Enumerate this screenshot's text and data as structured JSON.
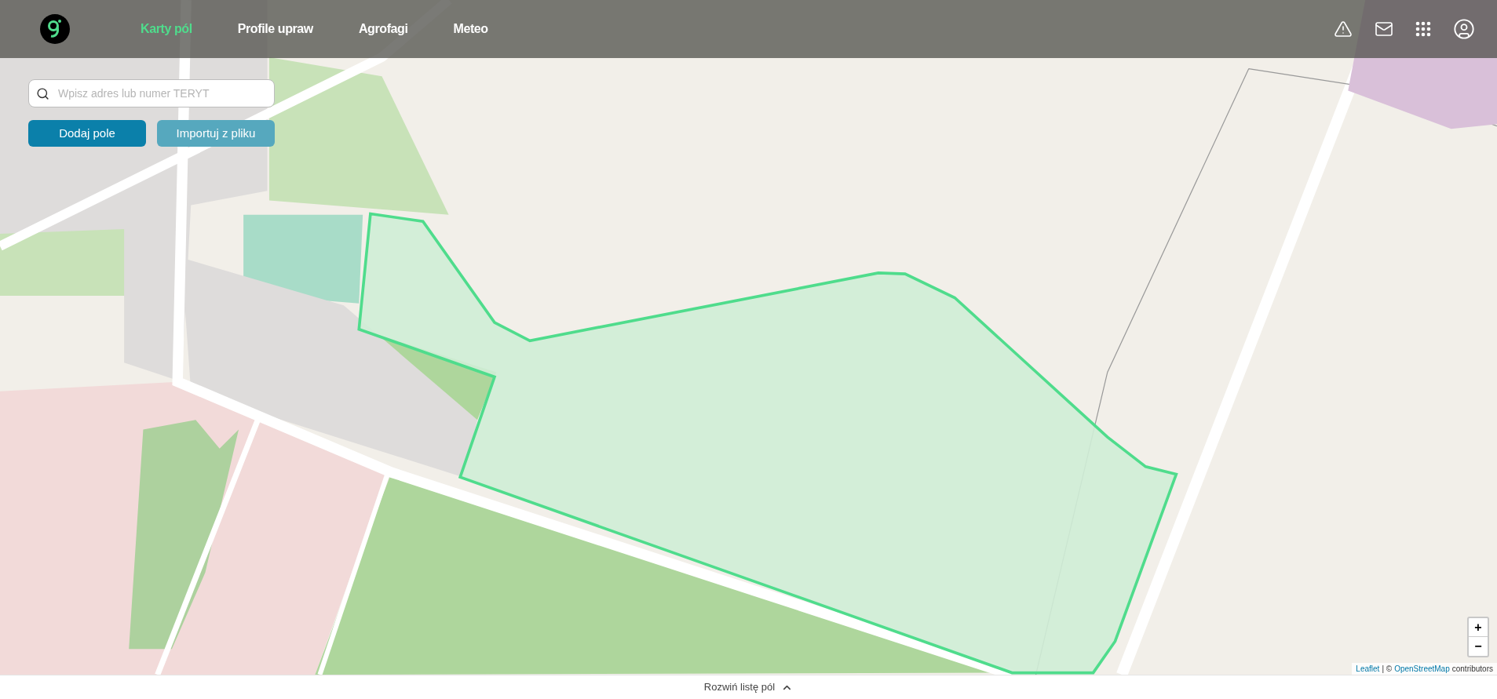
{
  "nav": {
    "items": [
      {
        "label": "Karty pól",
        "selected": true
      },
      {
        "label": "Profile upraw",
        "selected": false
      },
      {
        "label": "Agrofagi",
        "selected": false
      },
      {
        "label": "Meteo",
        "selected": false
      }
    ]
  },
  "search": {
    "placeholder": "Wpisz adres lub numer TERYT"
  },
  "buttons": [
    {
      "label": "Dodaj pole",
      "kind": "primary"
    },
    {
      "label": "Importuj z pliku",
      "kind": "secondary"
    }
  ],
  "zoom": {
    "in": "+",
    "out": "−"
  },
  "attribution": {
    "leaflet": "Leaflet",
    "separator": "| ©",
    "osm": "OpenStreetMap",
    "suffix": "contributors"
  },
  "bottom_bar": {
    "label": "Rozwiń listę pól"
  }
}
